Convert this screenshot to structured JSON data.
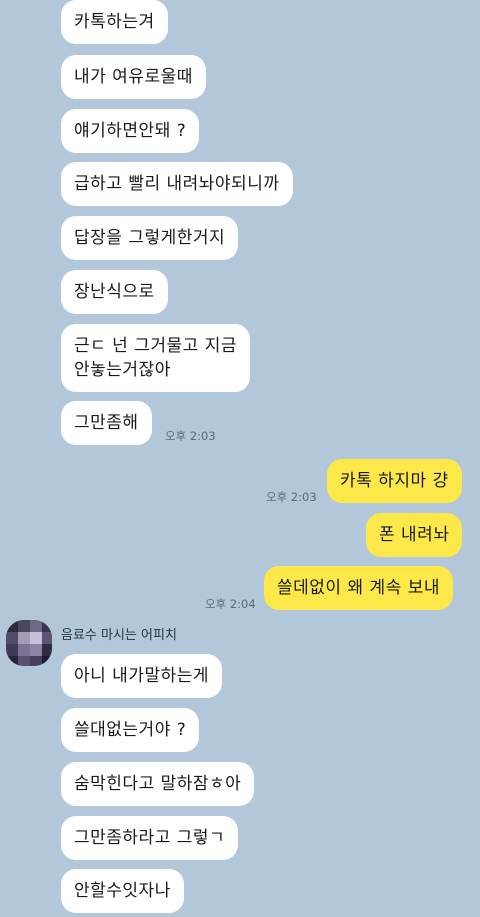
{
  "incoming_top": [
    "카톡하는겨",
    "내가 여유로울때",
    "얘기하면안돼 ?",
    "급하고 빨리 내려놔야되니까",
    "답장을 그렇게한거지",
    "장난식으로",
    "근ㄷ 넌 그거물고 지금\n안놓는거잖아",
    "그만좀해"
  ],
  "time_1": "오후 2:03",
  "outgoing": [
    "카톡 하지마 걍",
    "폰 내려놔",
    "쓸데없이 왜 계속 보내"
  ],
  "time_2": "오후 2:03",
  "time_3": "오후 2:04",
  "sender_name": "음료수 마시는 어피치",
  "incoming_bottom": [
    "아니 내가말하는게",
    "쓸대없는거야 ?",
    "숨막힌다고 말하잠ㅎ아",
    "그만좀하라고 그렇ㄱ",
    "안할수잇자나"
  ],
  "colors": {
    "background": "#b2c7d9",
    "incoming_bubble": "#ffffff",
    "outgoing_bubble": "#fde84a"
  }
}
